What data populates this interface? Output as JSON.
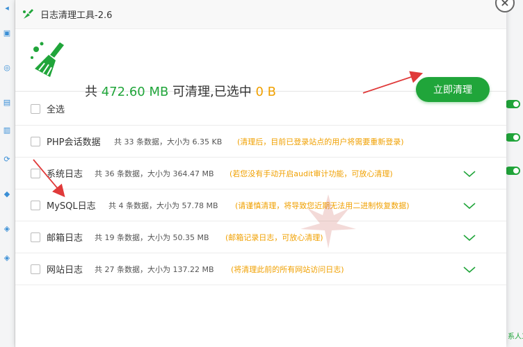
{
  "window": {
    "title": "日志清理工具-2.6",
    "close_label": "×"
  },
  "summary": {
    "prefix": "共 ",
    "total": "472.60 MB",
    "middle": " 可清理,已选中 ",
    "selected": "0 B",
    "button_label": "立即清理"
  },
  "select_all": {
    "label": "全选"
  },
  "items": [
    {
      "name": "PHP会话数据",
      "info": "共 33 条数据，大小为 6.35 KB",
      "note": "(清理后，目前已登录站点的用户将需要重新登录)",
      "expandable": false
    },
    {
      "name": "系统日志",
      "info": "共 36 条数据，大小为 364.47 MB",
      "note": "(若您没有手动开启audit审计功能，可放心清理)",
      "expandable": true
    },
    {
      "name": "MySQL日志",
      "info": "共 4 条数据，大小为 57.78 MB",
      "note": "(请谨慎清理，将导致您近期无法用二进制恢复数据)",
      "expandable": true
    },
    {
      "name": "邮箱日志",
      "info": "共 19 条数据，大小为 50.35 MB",
      "note": "(邮箱记录日志，可放心清理)",
      "expandable": true
    },
    {
      "name": "网站日志",
      "info": "共 27 条数据，大小为 137.22 MB",
      "note": "(将清理此前的所有网站访问日志)",
      "expandable": true
    }
  ],
  "background": {
    "right_text": "系人工"
  },
  "colors": {
    "accent": "#20a53a",
    "warning": "#f0a000",
    "annotation_arrow": "#e03a3a"
  },
  "icons": [
    "broom-icon",
    "app-logo-icon",
    "close-icon",
    "chevron-down-icon"
  ]
}
